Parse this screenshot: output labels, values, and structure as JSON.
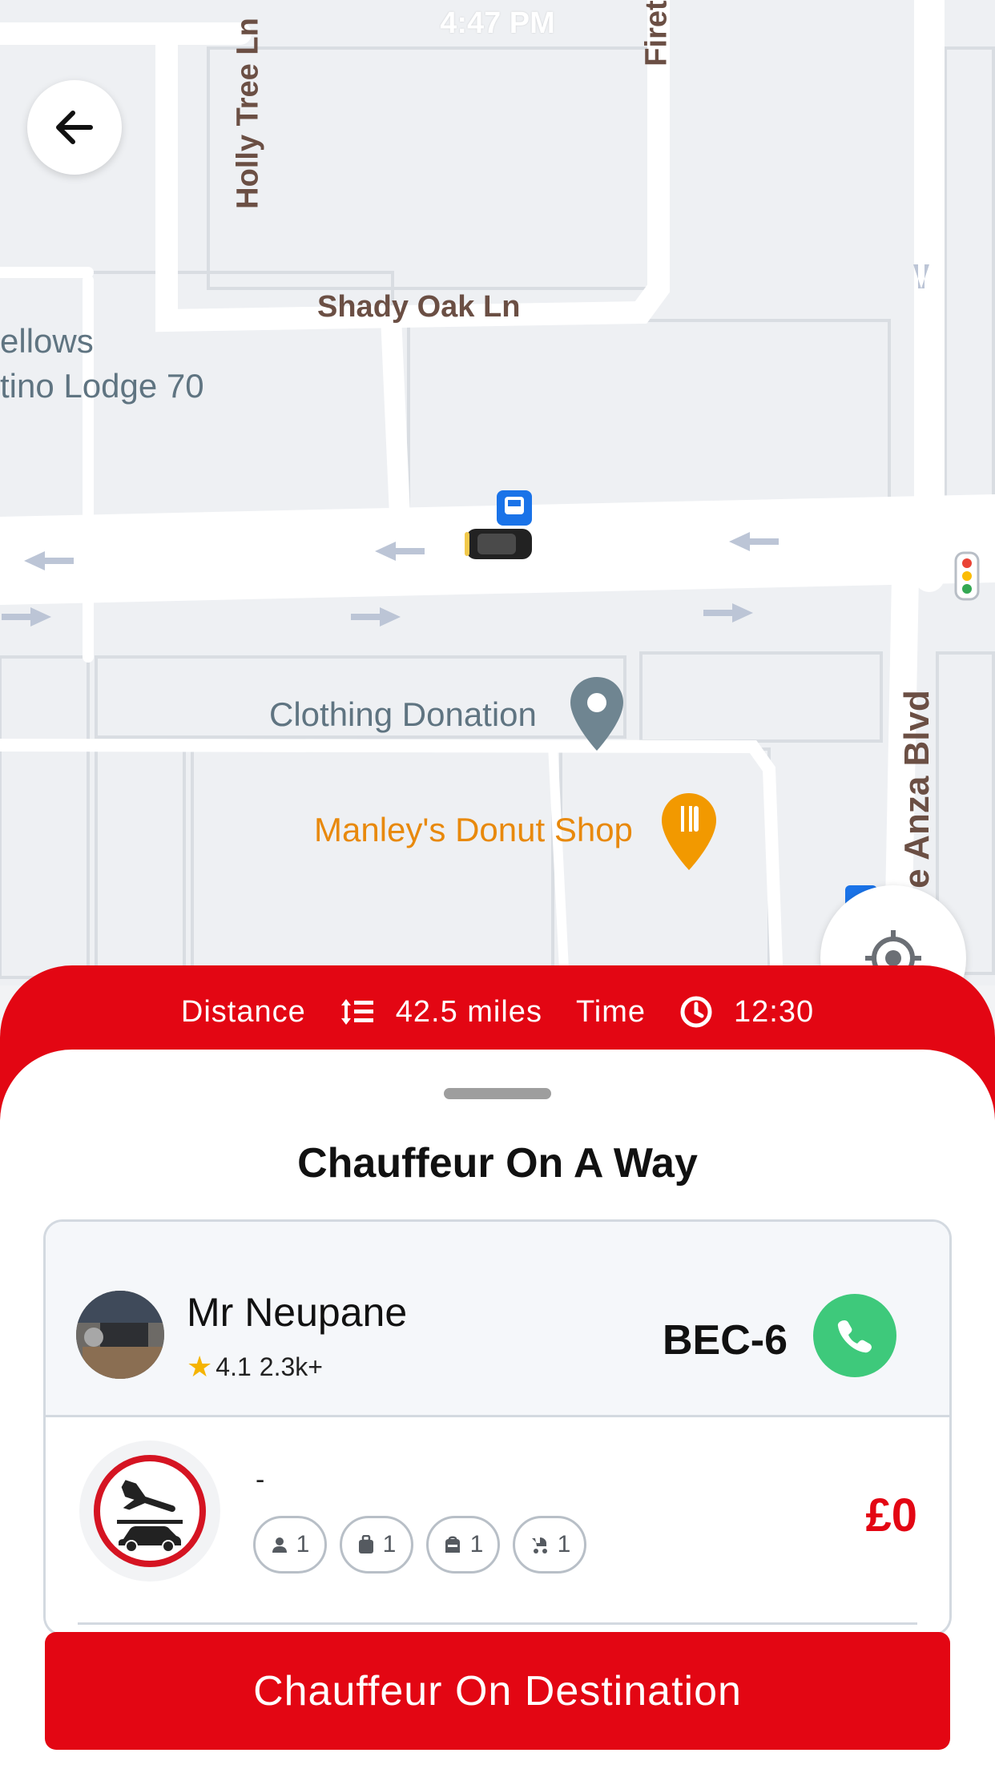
{
  "status_bar": {
    "time": "4:47 PM"
  },
  "map": {
    "streets": {
      "holly_tree": "Holly Tree Ln",
      "shady_oak": "Shady Oak Ln",
      "fire": "Firet",
      "de_anza": "e Anza Blvd"
    },
    "places": {
      "fellows": "ellows",
      "lodge": "tino Lodge 70",
      "clothing": "Clothing Donation",
      "donut": "Manley's Donut Shop"
    },
    "colors": {
      "road": "#ffffff",
      "land": "#eef0f3",
      "poi_gray": "#5f7481",
      "poi_orange": "#e8890c",
      "street_text": "#6b4f44"
    }
  },
  "info_bar": {
    "distance_label": "Distance",
    "distance_value": "42.5 miles",
    "time_label": "Time",
    "time_value": "12:30"
  },
  "sheet": {
    "title": "Chauffeur On A Way",
    "driver": {
      "name": "Mr Neupane",
      "rating": "4.1",
      "rating_count": "2.3k+",
      "plate": "BEC-6"
    },
    "trip": {
      "dash": "-",
      "passengers": "1",
      "luggage": "1",
      "hand_luggage": "1",
      "child_seats": "1",
      "price": "£0"
    }
  },
  "cta": {
    "label": "Chauffeur On Destination"
  },
  "theme": {
    "accent": "#e30613",
    "call_green": "#3ec97b"
  }
}
